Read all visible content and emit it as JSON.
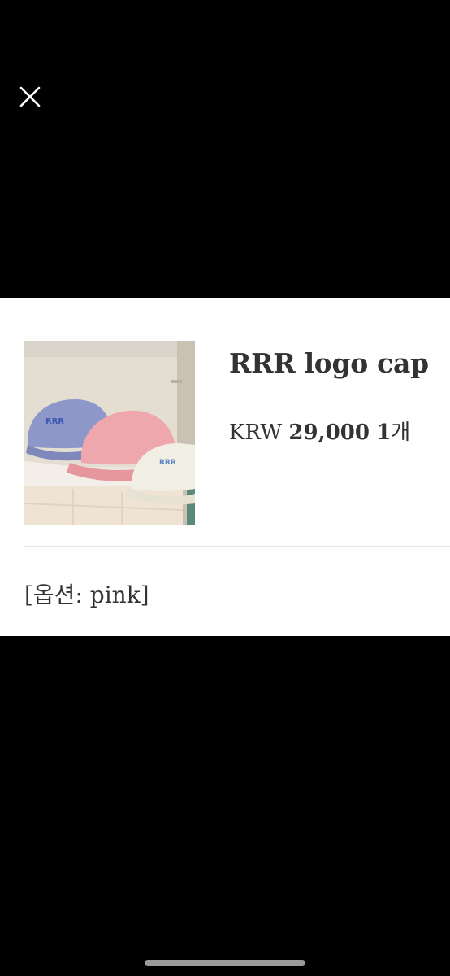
{
  "viewer": {
    "close_icon": "close-icon"
  },
  "product": {
    "name": "RRR logo cap",
    "currency": "KRW",
    "price": "29,000",
    "quantity_number": "1",
    "quantity_unit": "개",
    "option_label": "[옵션: pink]",
    "thumbnail": {
      "cap_colors": [
        "#8e97c9",
        "#eea7ad",
        "#f1efe4"
      ],
      "logo_color": "#3a58b0"
    }
  },
  "system": {
    "home_indicator_color": "#9a9a9a"
  }
}
